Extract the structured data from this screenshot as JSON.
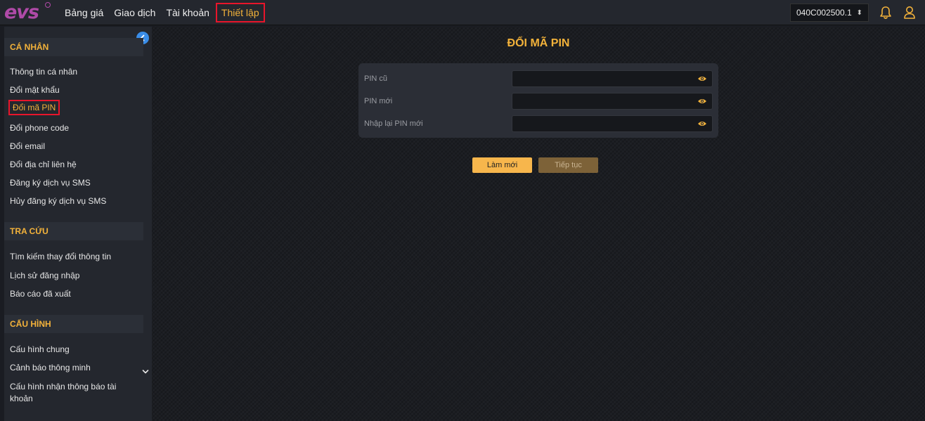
{
  "app": {
    "logo_text": "evs"
  },
  "nav": {
    "items": [
      {
        "label": "Bảng giá"
      },
      {
        "label": "Giao dịch"
      },
      {
        "label": "Tài khoản"
      },
      {
        "label": "Thiết lập"
      }
    ],
    "active": "Thiết lập"
  },
  "account": {
    "selected": "040C002500.1"
  },
  "icons": {
    "bell": "bell-icon",
    "user": "user-icon",
    "eye": "eye-icon",
    "collapse": "chevron-left-icon"
  },
  "colors": {
    "accent": "#f3b23a",
    "highlight_border": "#e8152b",
    "toggle": "#3a8de8"
  },
  "sidebar": {
    "sections": [
      {
        "title": "CÁ NHÂN",
        "items": [
          "Thông tin cá nhân",
          "Đổi mật khẩu",
          "Đổi mã PIN",
          "Đổi phone code",
          "Đổi email",
          "Đổi địa chỉ liên hệ",
          "Đăng ký dịch vụ SMS",
          "Hủy đăng ký dịch vụ SMS"
        ]
      },
      {
        "title": "TRA CỨU",
        "items": [
          "Tìm kiếm thay đổi thông tin",
          "Lịch sử đăng nhập",
          "Báo cáo đã xuất"
        ]
      },
      {
        "title": "CẤU HÌNH",
        "items": [
          "Cấu hình chung",
          "Cảnh báo thông minh",
          "Cấu hình nhận thông báo tài",
          "khoản"
        ]
      }
    ],
    "active_item": "Đổi mã PIN"
  },
  "main": {
    "title": "ĐỔI MÃ PIN",
    "fields": [
      {
        "label": "PIN cũ",
        "value": ""
      },
      {
        "label": "PIN mới",
        "value": ""
      },
      {
        "label": "Nhập lại PIN mới",
        "value": ""
      }
    ],
    "buttons": {
      "refresh": "Làm mới",
      "continue": "Tiếp tục"
    }
  }
}
